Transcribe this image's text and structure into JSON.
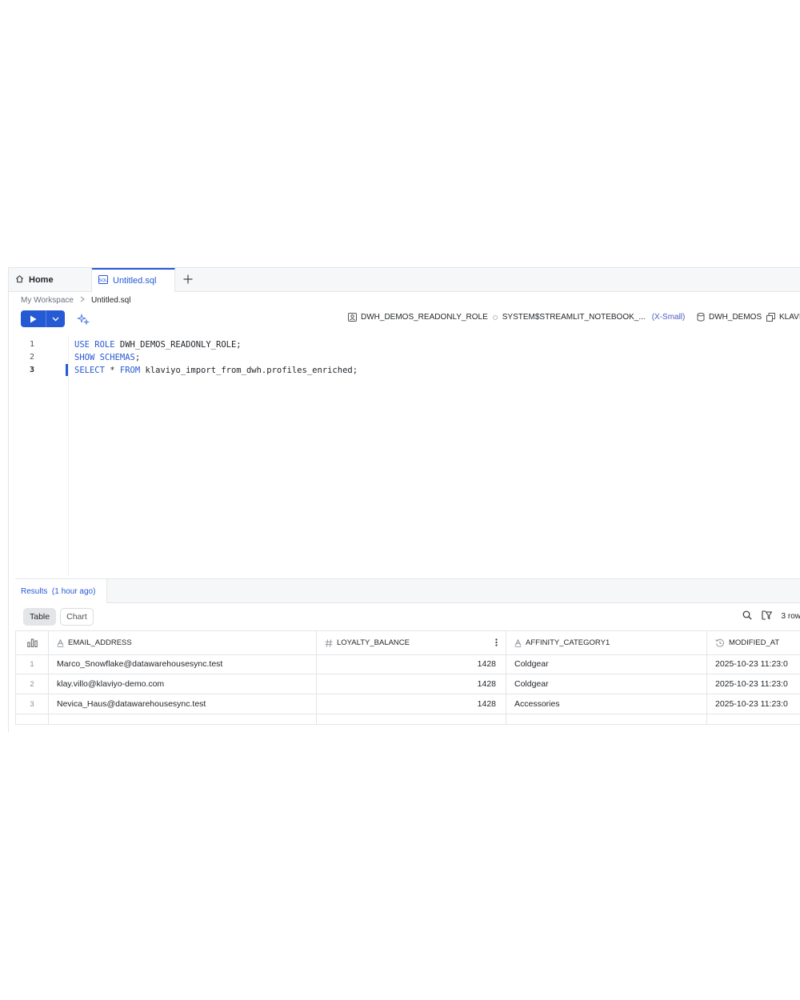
{
  "tabs": {
    "home_label": "Home",
    "active_label": "Untitled.sql",
    "add_label": "+"
  },
  "breadcrumb": {
    "workspace": "My Workspace",
    "separator": ">",
    "file": "Untitled.sql"
  },
  "context": {
    "role": "DWH_DEMOS_READONLY_ROLE",
    "warehouse": "SYSTEM$STREAMLIT_NOTEBOOK_...",
    "warehouse_size": "(X-Small)",
    "database": "DWH_DEMOS",
    "schema": "KLAVI"
  },
  "editor": {
    "line_numbers": [
      "1",
      "2",
      "3"
    ],
    "lines": [
      {
        "k1": "USE ROLE",
        "rest": " DWH_DEMOS_READONLY_ROLE;"
      },
      {
        "k1": "SHOW SCHEMAS",
        "rest": ";"
      },
      {
        "k1": "SELECT",
        "mid": " * ",
        "k2": "FROM",
        "rest": " klaviyo_import_from_dwh.profiles_enriched;"
      }
    ]
  },
  "results": {
    "tab_label": "Results",
    "tab_time": "(1 hour ago)",
    "view_table": "Table",
    "view_chart": "Chart",
    "row_count": "3 row",
    "columns": [
      {
        "name": "EMAIL_ADDRESS",
        "type_icon": "text-type-icon"
      },
      {
        "name": "LOYALTY_BALANCE",
        "type_icon": "number-type-icon"
      },
      {
        "name": "AFFINITY_CATEGORY1",
        "type_icon": "text-type-icon"
      },
      {
        "name": "MODIFIED_AT",
        "type_icon": "timestamp-type-icon"
      }
    ],
    "rows": [
      {
        "n": "1",
        "email": "Marco_Snowflake@datawarehousesync.test",
        "loyalty": "1428",
        "affinity": "Coldgear",
        "modified": "2025-10-23 11:23:0"
      },
      {
        "n": "2",
        "email": "klay.villo@klaviyo-demo.com",
        "loyalty": "1428",
        "affinity": "Coldgear",
        "modified": "2025-10-23 11:23:0"
      },
      {
        "n": "3",
        "email": "Nevica_Haus@datawarehousesync.test",
        "loyalty": "1428",
        "affinity": "Accessories",
        "modified": "2025-10-23 11:23:0"
      }
    ]
  },
  "colors": {
    "accent": "#2659d4",
    "border": "#e3e5e8"
  }
}
